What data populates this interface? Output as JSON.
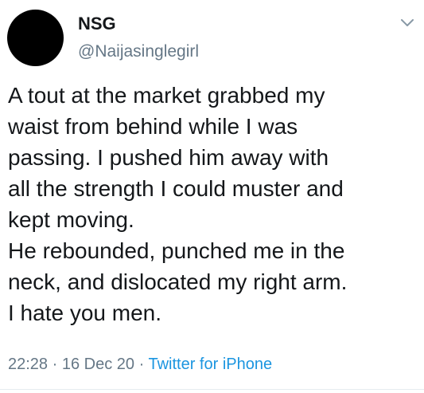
{
  "author": {
    "name": "NSG",
    "handle": "@Naijasinglegirl",
    "avatar_color": "#000000"
  },
  "tweet": {
    "lines": [
      "A tout at the market grabbed my",
      "waist from behind while I was",
      "passing. I pushed him away with",
      "all the strength I could muster and",
      "kept moving.",
      "He rebounded, punched me in the",
      "neck, and dislocated my right arm.",
      "I hate you men."
    ],
    "time": "22:28",
    "date": "16 Dec 20",
    "separator": "·",
    "source": "Twitter for iPhone"
  },
  "icons": {
    "menu": "chevron-down-icon"
  },
  "colors": {
    "text": "#14171a",
    "secondary": "#657786",
    "link": "#1b95e0",
    "divider": "#e6ecf0"
  }
}
